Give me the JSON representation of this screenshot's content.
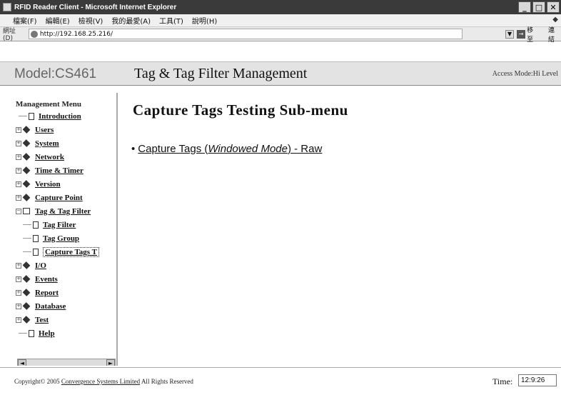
{
  "window": {
    "title": "RFID Reader Client - Microsoft Internet Explorer",
    "controls": [
      "minimize-icon",
      "maximize-icon",
      "close-icon"
    ]
  },
  "menubar": {
    "items": [
      "檔案(F)",
      "編輯(E)",
      "檢視(V)",
      "我的最愛(A)",
      "工具(T)",
      "說明(H)"
    ]
  },
  "address": {
    "label": "網址(D)",
    "url": "http://192.168.25.216/",
    "go_label": "移至",
    "links_label": "連結"
  },
  "header": {
    "model": "Model:CS461",
    "title": "Tag & Tag Filter Management",
    "access_mode": "Access Mode:Hi Level"
  },
  "sidebar": {
    "title": "Management Menu",
    "items": [
      {
        "label": "Introduction",
        "type": "page",
        "indent": 0
      },
      {
        "label": "Users",
        "type": "folder",
        "indent": 0
      },
      {
        "label": "System",
        "type": "folder",
        "indent": 0
      },
      {
        "label": "Network",
        "type": "folder",
        "indent": 0
      },
      {
        "label": "Time & Timer",
        "type": "folder",
        "indent": 0
      },
      {
        "label": "Version",
        "type": "folder",
        "indent": 0
      },
      {
        "label": "Capture Point",
        "type": "folder",
        "indent": 0
      },
      {
        "label": "Tag & Tag Filter",
        "type": "open-folder",
        "indent": 0
      },
      {
        "label": "Tag Filter",
        "type": "page",
        "indent": 1
      },
      {
        "label": "Tag Group",
        "type": "page",
        "indent": 1
      },
      {
        "label": "Capture Tags T",
        "type": "page",
        "indent": 1,
        "selected": true
      },
      {
        "label": "I/O",
        "type": "folder",
        "indent": 0
      },
      {
        "label": "Events",
        "type": "folder",
        "indent": 0
      },
      {
        "label": "Report",
        "type": "folder",
        "indent": 0
      },
      {
        "label": "Database",
        "type": "folder",
        "indent": 0
      },
      {
        "label": "Test",
        "type": "folder",
        "indent": 0
      },
      {
        "label": "Help",
        "type": "page",
        "indent": 0
      }
    ]
  },
  "main": {
    "title": "Capture Tags Testing Sub-menu",
    "link_prefix": "Capture Tags (",
    "link_italic": "Windowed Mode",
    "link_suffix": ") - Raw"
  },
  "footer": {
    "copyright_prefix": "Copyright© 2005",
    "company": "Convergence Systems Limited",
    "copyright_suffix": "All Rights Reserved",
    "time_label": "Time:",
    "time_value": "12:9:26"
  }
}
